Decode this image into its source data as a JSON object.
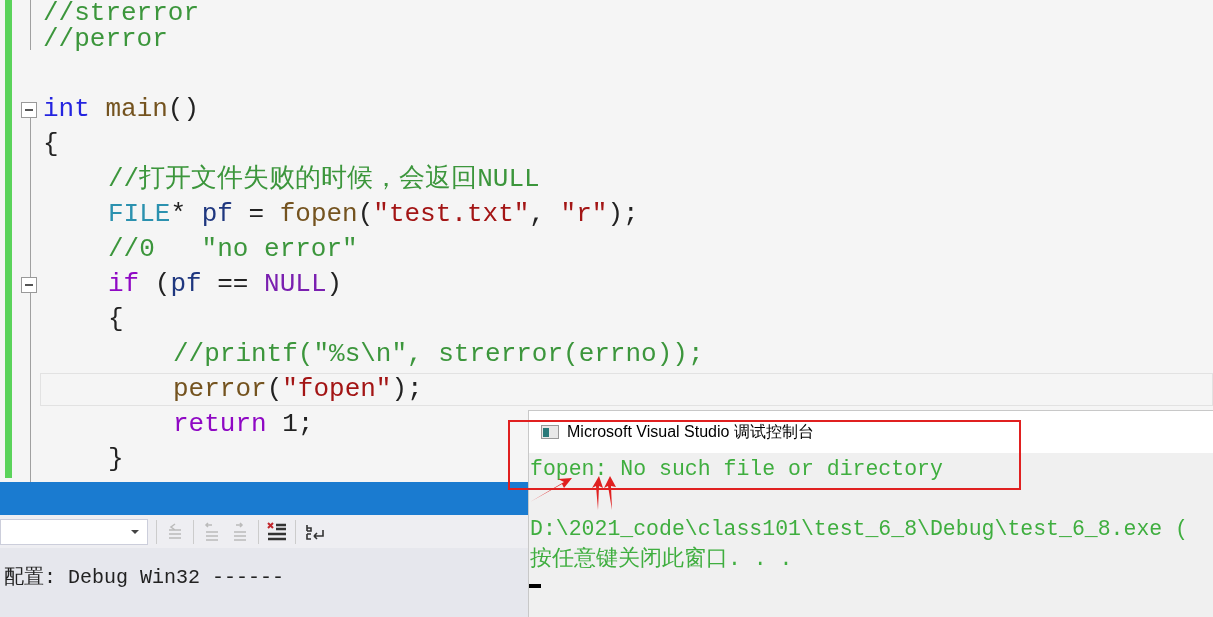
{
  "editor": {
    "lines": [
      {
        "kind": "code",
        "fold": false,
        "current": false,
        "tokens": [
          {
            "kind": "comment",
            "text": "//strerror"
          }
        ]
      },
      {
        "kind": "code",
        "fold": false,
        "current": false,
        "tokens": [
          {
            "kind": "comment",
            "text": "//perror"
          }
        ]
      },
      {
        "kind": "blank"
      },
      {
        "kind": "code",
        "fold": true,
        "current": false,
        "tokens": [
          {
            "kind": "keyword",
            "text": "int"
          },
          {
            "kind": "function",
            "text": "main"
          },
          {
            "kind": "plain",
            "text": "()"
          }
        ]
      },
      {
        "kind": "code",
        "fold": false,
        "current": false,
        "tokens": [
          {
            "kind": "plain",
            "text": "{"
          }
        ],
        "children": [
          {
            "kind": "code",
            "fold": false,
            "current": false,
            "tokens": [
              {
                "kind": "comment",
                "text": "//打开文件失败的时候，会返回NULL"
              }
            ]
          },
          {
            "kind": "code",
            "fold": false,
            "current": false,
            "tokens": [
              {
                "kind": "type",
                "text": "FILE"
              },
              {
                "kind": "plain",
                "text": "*"
              },
              {
                "kind": "variable",
                "text": "pf"
              },
              {
                "kind": "plain",
                "text": "="
              },
              {
                "kind": "function",
                "text": "fopen"
              },
              {
                "kind": "plain",
                "text": "("
              },
              {
                "kind": "string",
                "text": "\"test.txt\""
              },
              {
                "kind": "plain",
                "text": ","
              },
              {
                "kind": "string",
                "text": "\"r\""
              },
              {
                "kind": "plain",
                "text": ");"
              }
            ]
          },
          {
            "kind": "code",
            "fold": false,
            "current": false,
            "tokens": [
              {
                "kind": "comment",
                "text": "//0   \"no error\""
              }
            ]
          },
          {
            "kind": "code",
            "fold": true,
            "current": false,
            "tokens": [
              {
                "kind": "control",
                "text": "if"
              },
              {
                "kind": "plain",
                "text": "("
              },
              {
                "kind": "variable",
                "text": "pf"
              },
              {
                "kind": "plain",
                "text": "=="
              },
              {
                "kind": "macro",
                "text": "NULL"
              },
              {
                "kind": "plain",
                "text": ")"
              }
            ]
          },
          {
            "kind": "code",
            "fold": false,
            "current": false,
            "tokens": [
              {
                "kind": "plain",
                "text": "{"
              }
            ],
            "children": [
              {
                "kind": "code",
                "fold": false,
                "current": false,
                "tokens": [
                  {
                    "kind": "comment",
                    "text": "//printf(\"%s\\n\", strerror(errno));"
                  }
                ]
              },
              {
                "kind": "code",
                "fold": false,
                "current": true,
                "tokens": [
                  {
                    "kind": "function",
                    "text": "perror"
                  },
                  {
                    "kind": "plain",
                    "text": "("
                  },
                  {
                    "kind": "string",
                    "text": "\"fopen\""
                  },
                  {
                    "kind": "plain",
                    "text": ");"
                  }
                ]
              },
              {
                "kind": "code",
                "fold": false,
                "current": false,
                "tokens": [
                  {
                    "kind": "control",
                    "text": "return"
                  },
                  {
                    "kind": "plain",
                    "text": "1;"
                  }
                ]
              }
            ]
          },
          {
            "kind": "code",
            "fold": false,
            "current": false,
            "tokens": [
              {
                "kind": "plain",
                "text": "}"
              }
            ]
          }
        ]
      }
    ]
  },
  "output_panel": {
    "text": "配置: Debug Win32 ------"
  },
  "console": {
    "title": "Microsoft Visual Studio 调试控制台",
    "error_line": "fopen: No such file or directory",
    "exit_lines": [
      "D:\\2021_code\\class101\\test_6_8\\Debug\\test_6_8.exe (",
      "按任意键关闭此窗口. . ."
    ]
  }
}
